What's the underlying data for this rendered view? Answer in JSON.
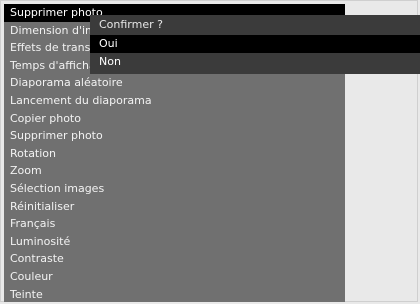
{
  "menu": {
    "items": [
      {
        "label": "Supprimer photo"
      },
      {
        "label": "Dimension d'image"
      },
      {
        "label": "Effets de transition"
      },
      {
        "label": "Temps d'affichage"
      },
      {
        "label": "Diaporama aléatoire"
      },
      {
        "label": "Lancement du diaporama"
      },
      {
        "label": "Copier photo"
      },
      {
        "label": "Supprimer photo"
      },
      {
        "label": "Rotation"
      },
      {
        "label": "Zoom"
      },
      {
        "label": "Sélection images"
      },
      {
        "label": "Réinitialiser"
      },
      {
        "label": "Français"
      },
      {
        "label": "Luminosité"
      },
      {
        "label": "Contraste"
      },
      {
        "label": "Couleur"
      },
      {
        "label": "Teinte"
      }
    ],
    "selected_index": 0
  },
  "confirm_dialog": {
    "title": "Confirmer ?",
    "options": [
      {
        "label": "Oui"
      },
      {
        "label": "Non"
      }
    ],
    "selected_index": 0
  }
}
